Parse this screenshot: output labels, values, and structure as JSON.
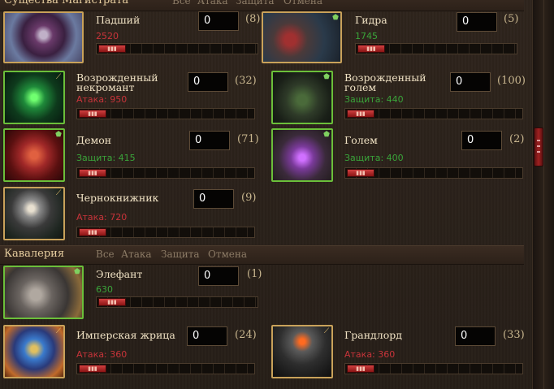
{
  "sections": [
    {
      "title": "Существа Магистрата",
      "filters": [
        "Все",
        "Атака",
        "Защита",
        "Отмена"
      ]
    },
    {
      "title": "Кавалерия",
      "filters": [
        "Все",
        "Атака",
        "Защита",
        "Отмена"
      ]
    }
  ],
  "units": [
    {
      "name": "Падший",
      "stat": "2520",
      "qty": "0",
      "avail": "(8)",
      "portrait": "fallen-portrait",
      "badge": ""
    },
    {
      "name": "Гидра",
      "stat": "1745",
      "qty": "0",
      "avail": "(5)",
      "portrait": "hydra-portrait",
      "badge": "shield-icon"
    },
    {
      "name": "Возрожденный некромант",
      "stat": "Атака: 950",
      "qty": "0",
      "avail": "(32)",
      "portrait": "reborn-necromancer-portrait",
      "badge": "sword-icon"
    },
    {
      "name": "Возрожденный голем",
      "stat": "Защита: 440",
      "qty": "0",
      "avail": "(100)",
      "portrait": "reborn-golem-portrait",
      "badge": "shield-icon"
    },
    {
      "name": "Демон",
      "stat": "Защита: 415",
      "qty": "0",
      "avail": "(71)",
      "portrait": "demon-portrait",
      "badge": "shield-icon"
    },
    {
      "name": "Голем",
      "stat": "Защита: 400",
      "qty": "0",
      "avail": "(2)",
      "portrait": "golem-portrait",
      "badge": "shield-icon"
    },
    {
      "name": "Чернокнижник",
      "stat": "Атака: 720",
      "qty": "0",
      "avail": "(9)",
      "portrait": "warlock-portrait",
      "badge": "sword-icon"
    },
    {
      "name": "Элефант",
      "stat": "630",
      "qty": "0",
      "avail": "(1)",
      "portrait": "elephant-portrait",
      "badge": "shield-icon"
    },
    {
      "name": "Имперская жрица",
      "stat": "Атака: 360",
      "qty": "0",
      "avail": "(24)",
      "portrait": "imperial-priestess-portrait",
      "badge": "sword-icon"
    },
    {
      "name": "Грандлорд",
      "stat": "Атака: 360",
      "qty": "0",
      "avail": "(33)",
      "portrait": "grandlord-portrait",
      "badge": "sword-icon"
    }
  ],
  "colors": {
    "attack": "#c8343a",
    "defense": "#3aa43a",
    "gold_frame": "#c9a25a",
    "green_frame": "#6bbf3a"
  }
}
